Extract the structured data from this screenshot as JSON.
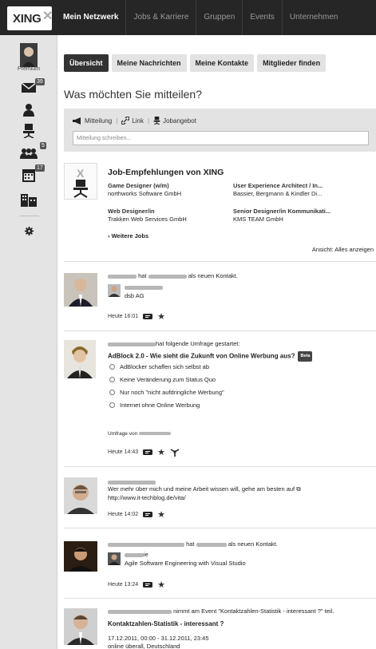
{
  "brand": {
    "logo_text": "XING"
  },
  "topnav": [
    {
      "label": "Mein Netzwerk",
      "active": true
    },
    {
      "label": "Jobs & Karriere"
    },
    {
      "label": "Gruppen"
    },
    {
      "label": "Events"
    },
    {
      "label": "Unternehmen"
    }
  ],
  "sidebar": {
    "premium_label": "Premium",
    "messages_count": "39",
    "contacts_count": "5",
    "events_count": "17"
  },
  "tabs": [
    {
      "label": "Übersicht",
      "active": true
    },
    {
      "label": "Meine Nachrichten"
    },
    {
      "label": "Meine Kontakte"
    },
    {
      "label": "Mitglieder finden"
    }
  ],
  "status": {
    "question": "Was möchten Sie mitteilen?",
    "action_message": "Mitteilung",
    "action_link": "Link",
    "action_job": "Jobangebot",
    "placeholder": "Mitteilung schreiben..."
  },
  "jobs": {
    "title": "Job-Empfehlungen von XING",
    "items": [
      {
        "title": "Game Designer (w/m)",
        "company": "northworks Software GmbH"
      },
      {
        "title": "User Experience Architect / In...",
        "company": "Bassier, Bergmann & Kindler Di..."
      },
      {
        "title": "Web Designer/in",
        "company": "Trakken Web Services GmbH"
      },
      {
        "title": "Senior Designer/in Kommunikati...",
        "company": "KMS TEAM GmbH"
      }
    ],
    "more": "Weitere Jobs",
    "show_all": "Ansicht: Alles anzeigen"
  },
  "feed": [
    {
      "text_before": "hat",
      "text_after": "als neuen Kontakt.",
      "contact_company": "dsb AG",
      "time": "Heute 16:01"
    },
    {
      "text_after": "hat folgende Umfrage gestartet:",
      "poll_title": "AdBlock 2.0 - Wie sieht die Zukunft von Online Werbung aus?",
      "beta": "Beta",
      "options": [
        "AdBlocker schaffen sich selbst ab",
        "Keine Veränderung zum Status Quo",
        "Nur noch \"nicht aufdringliche Werbung\"",
        "Internet ohne Online Werbung"
      ],
      "poll_by": "Umfrage von",
      "time": "Heute 14:43"
    },
    {
      "text": "Wer mehr über mich und meine Arbeit wissen will, gehe am besten auf",
      "url": "http://www.it-techblog.de/vita/",
      "time": "Heute 14:02"
    },
    {
      "text_before": "hat",
      "text_after": "als neuen Kontakt.",
      "contact_name_suffix": "ie",
      "contact_company": "Agile Software Engineering with Visual Studio",
      "time": "Heute 13:24"
    },
    {
      "text_after": "nimmt am Event \"Kontaktzahlen-Statistik - interessant ?\" teil.",
      "event_title": "Kontaktzahlen-Statistik - interessant ?",
      "event_date": "17.12.2011, 00:00 - 31.12.2011, 23:45",
      "event_place": "online überall, Deutschland"
    }
  ]
}
